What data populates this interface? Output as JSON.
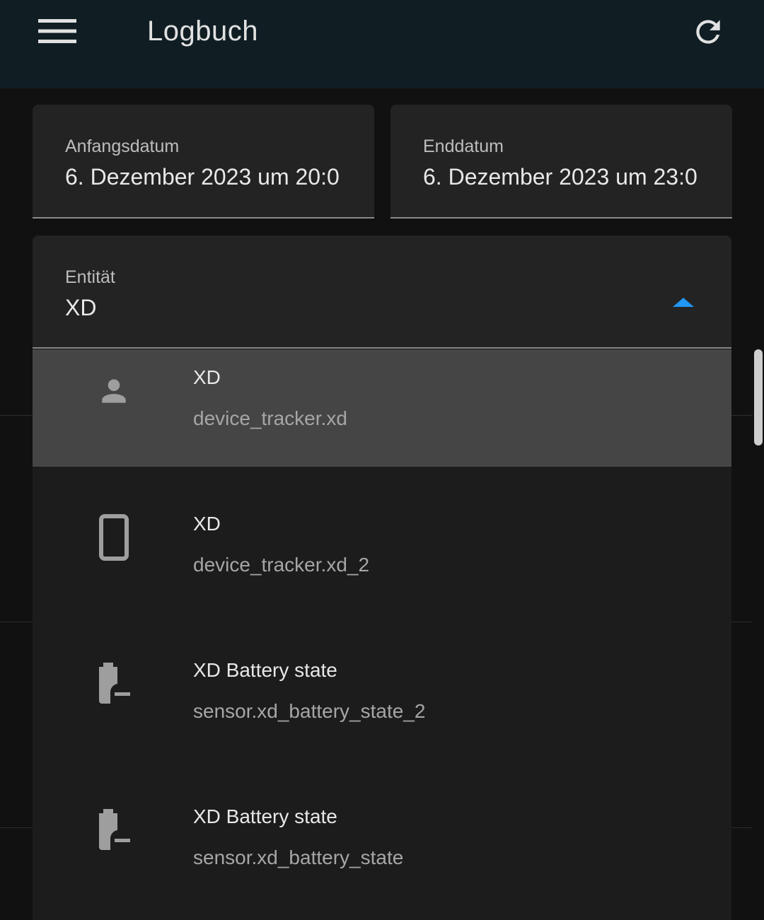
{
  "app_bar": {
    "title": "Logbuch",
    "menu_icon": "menu-icon",
    "refresh_icon": "refresh-icon"
  },
  "date_range": {
    "start": {
      "label": "Anfangsdatum",
      "value": "6. Dezember 2023 um 20:0"
    },
    "end": {
      "label": "Enddatum",
      "value": "6. Dezember 2023 um 23:0"
    }
  },
  "entity_picker": {
    "label": "Entität",
    "value": "XD",
    "toggle_icon": "caret-up-icon",
    "accent_color": "#2196f3",
    "options": [
      {
        "title": "XD",
        "subtitle": "device_tracker.xd",
        "icon": "account-icon",
        "selected": true
      },
      {
        "title": "XD",
        "subtitle": "device_tracker.xd_2",
        "icon": "cellphone-icon",
        "selected": false
      },
      {
        "title": "XD Battery state",
        "subtitle": "sensor.xd_battery_state_2",
        "icon": "battery-charging-icon",
        "selected": false
      },
      {
        "title": "XD Battery state",
        "subtitle": "sensor.xd_battery_state",
        "icon": "battery-charging-icon",
        "selected": false
      }
    ]
  },
  "colors": {
    "app_bar_bg": "#101e24",
    "page_bg": "#111111",
    "field_bg": "#232323",
    "selected_row_bg": "#454545",
    "icon_gray": "#9e9e9e"
  }
}
